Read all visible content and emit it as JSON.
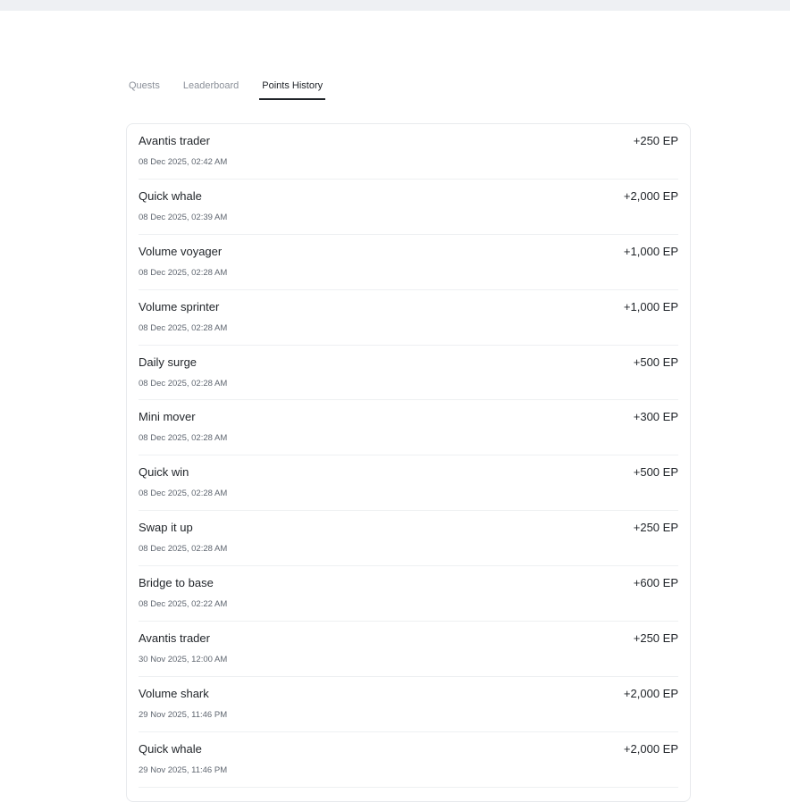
{
  "tabs": [
    {
      "label": "Quests",
      "active": false
    },
    {
      "label": "Leaderboard",
      "active": false
    },
    {
      "label": "Points History",
      "active": true
    }
  ],
  "history": [
    {
      "title": "Avantis trader",
      "date": "08 Dec 2025, 02:42 AM",
      "points": "+250 EP"
    },
    {
      "title": "Quick whale",
      "date": "08 Dec 2025, 02:39 AM",
      "points": "+2,000 EP"
    },
    {
      "title": "Volume voyager",
      "date": "08 Dec 2025, 02:28 AM",
      "points": "+1,000 EP"
    },
    {
      "title": "Volume sprinter",
      "date": "08 Dec 2025, 02:28 AM",
      "points": "+1,000 EP"
    },
    {
      "title": "Daily surge",
      "date": "08 Dec 2025, 02:28 AM",
      "points": "+500 EP"
    },
    {
      "title": "Mini mover",
      "date": "08 Dec 2025, 02:28 AM",
      "points": "+300 EP"
    },
    {
      "title": "Quick win",
      "date": "08 Dec 2025, 02:28 AM",
      "points": "+500 EP"
    },
    {
      "title": "Swap it up",
      "date": "08 Dec 2025, 02:28 AM",
      "points": "+250 EP"
    },
    {
      "title": "Bridge to base",
      "date": "08 Dec 2025, 02:22 AM",
      "points": "+600 EP"
    },
    {
      "title": "Avantis trader",
      "date": "30 Nov 2025, 12:00 AM",
      "points": "+250 EP"
    },
    {
      "title": "Volume shark",
      "date": "29 Nov 2025, 11:46 PM",
      "points": "+2,000 EP"
    },
    {
      "title": "Quick whale",
      "date": "29 Nov 2025, 11:46 PM",
      "points": "+2,000 EP"
    }
  ]
}
